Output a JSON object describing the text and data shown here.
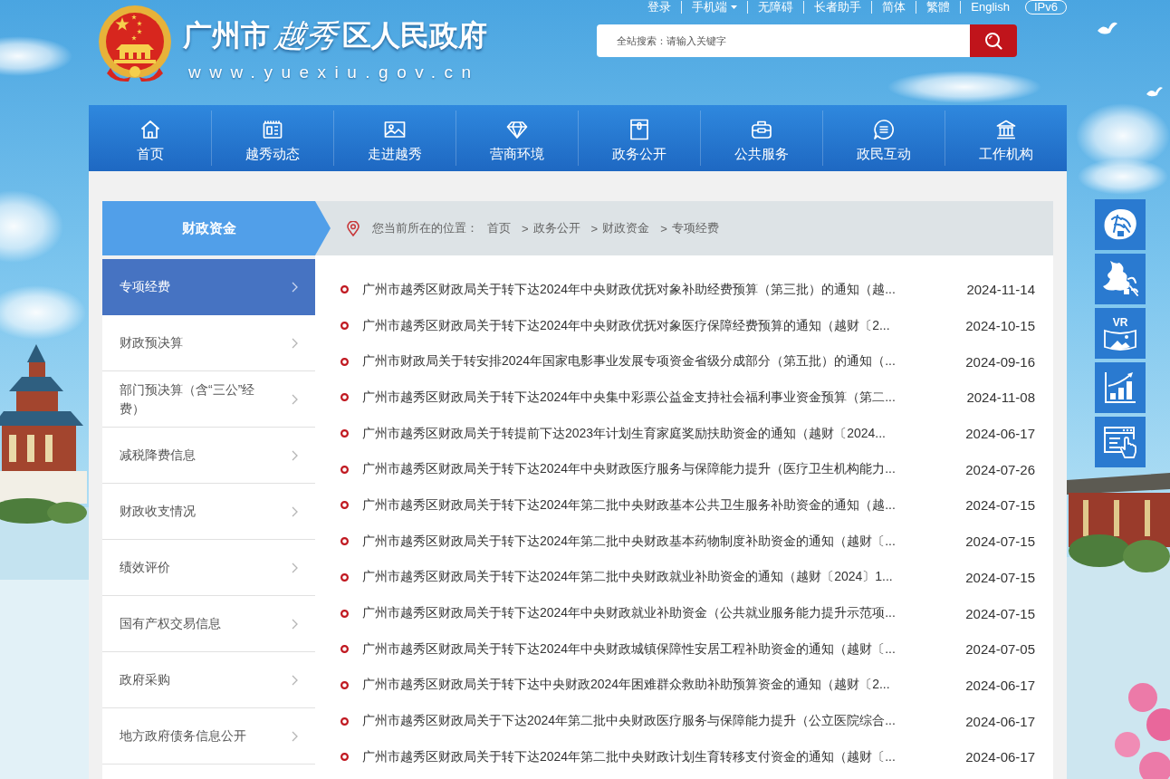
{
  "header": {
    "top_links": [
      {
        "label": "登录",
        "dropdown": false
      },
      {
        "label": "手机端",
        "dropdown": true
      },
      {
        "label": "无障碍",
        "dropdown": false
      },
      {
        "label": "长者助手",
        "dropdown": false
      },
      {
        "label": "简体",
        "dropdown": false
      },
      {
        "label": "繁體",
        "dropdown": false
      },
      {
        "label": "English",
        "dropdown": false
      }
    ],
    "ipv6_badge": "IPv6",
    "site_title": {
      "city": "广州市",
      "district_calligraphy": "越秀",
      "suffix": "区人民政府"
    },
    "url": "www.yuexiu.gov.cn",
    "search": {
      "placeholder": "全站搜索：请输入关键字"
    }
  },
  "nav": [
    {
      "label": "首页"
    },
    {
      "label": "越秀动态"
    },
    {
      "label": "走进越秀"
    },
    {
      "label": "营商环境"
    },
    {
      "label": "政务公开"
    },
    {
      "label": "公共服务"
    },
    {
      "label": "政民互动"
    },
    {
      "label": "工作机构"
    }
  ],
  "sidebar": {
    "title": "财政资金",
    "items": [
      {
        "label": "专项经费",
        "selected": true
      },
      {
        "label": "财政预决算",
        "selected": false
      },
      {
        "label": "部门预决算（含“三公”经费）",
        "selected": false
      },
      {
        "label": "减税降费信息",
        "selected": false
      },
      {
        "label": "财政收支情况",
        "selected": false
      },
      {
        "label": "绩效评价",
        "selected": false
      },
      {
        "label": "国有产权交易信息",
        "selected": false
      },
      {
        "label": "政府采购",
        "selected": false
      },
      {
        "label": "地方政府债务信息公开",
        "selected": false
      }
    ]
  },
  "breadcrumb": {
    "prefix": "您当前所在的位置：",
    "separator": ">",
    "items": [
      "首页",
      "政务公开",
      "财政资金",
      "专项经费"
    ]
  },
  "articles": [
    {
      "title": "广州市越秀区财政局关于转下达2024年中央财政优抚对象补助经费预算（第三批）的通知（越...",
      "date": "2024-11-14"
    },
    {
      "title": "广州市越秀区财政局关于转下达2024年中央财政优抚对象医疗保障经费预算的通知（越财〔2...",
      "date": "2024-10-15"
    },
    {
      "title": "广州市财政局关于转安排2024年国家电影事业发展专项资金省级分成部分（第五批）的通知（...",
      "date": "2024-09-16"
    },
    {
      "title": "广州市越秀区财政局关于转下达2024年中央集中彩票公益金支持社会福利事业资金预算（第二...",
      "date": "2024-11-08"
    },
    {
      "title": "广州市越秀区财政局关于转提前下达2023年计划生育家庭奖励扶助资金的通知（越财〔2024...",
      "date": "2024-06-17"
    },
    {
      "title": "广州市越秀区财政局关于转下达2024年中央财政医疗服务与保障能力提升（医疗卫生机构能力...",
      "date": "2024-07-26"
    },
    {
      "title": "广州市越秀区财政局关于转下达2024年第二批中央财政基本公共卫生服务补助资金的通知（越...",
      "date": "2024-07-15"
    },
    {
      "title": "广州市越秀区财政局关于转下达2024年第二批中央财政基本药物制度补助资金的通知（越财〔...",
      "date": "2024-07-15"
    },
    {
      "title": "广州市越秀区财政局关于转下达2024年第二批中央财政就业补助资金的通知（越财〔2024〕1...",
      "date": "2024-07-15"
    },
    {
      "title": "广州市越秀区财政局关于转下达2024年中央财政就业补助资金（公共就业服务能力提升示范项...",
      "date": "2024-07-15"
    },
    {
      "title": "广州市越秀区财政局关于转下达2024年中央财政城镇保障性安居工程补助资金的通知（越财〔...",
      "date": "2024-07-05"
    },
    {
      "title": "广州市越秀区财政局关于转下达中央财政2024年困难群众救助补助预算资金的通知（越财〔2...",
      "date": "2024-06-17"
    },
    {
      "title": "广州市越秀区财政局关于下达2024年第二批中央财政医疗服务与保障能力提升（公立医院综合...",
      "date": "2024-06-17"
    },
    {
      "title": "广州市越秀区财政局关于转下达2024年第二批中央财政计划生育转移支付资金的通知（越财〔...",
      "date": "2024-06-17"
    }
  ],
  "side_tools": {
    "vr_label": "VR"
  }
}
